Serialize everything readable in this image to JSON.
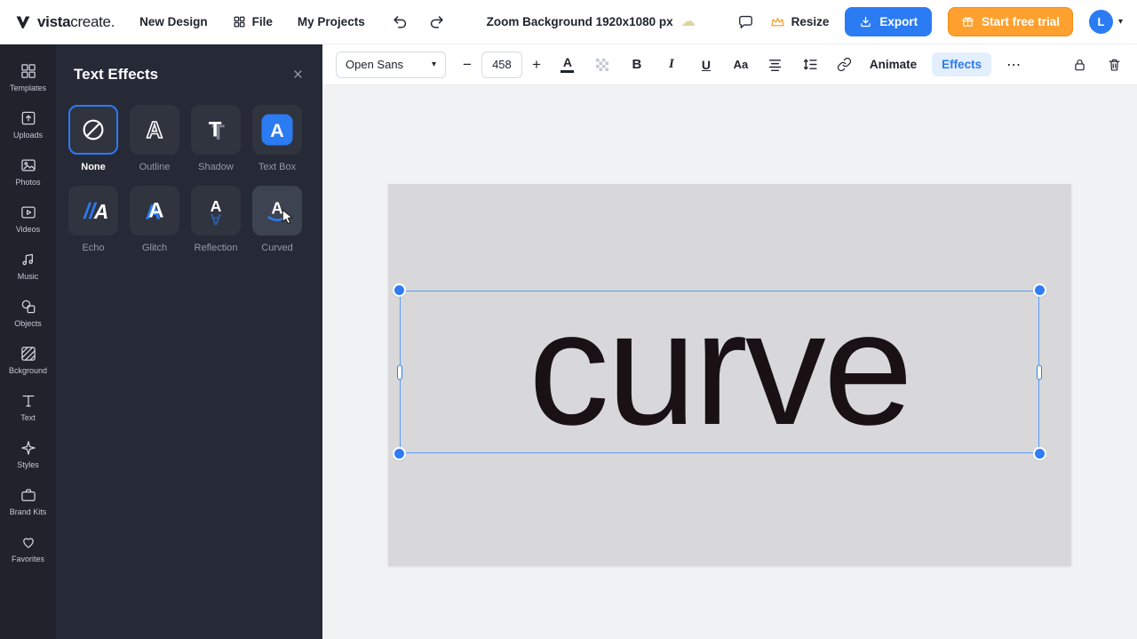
{
  "header": {
    "logo_bold": "vista",
    "logo_rest": "create.",
    "nav_new_design": "New Design",
    "nav_file": "File",
    "nav_my_projects": "My Projects",
    "doc_title": "Zoom Background 1920x1080 px",
    "resize_label": "Resize",
    "export_label": "Export",
    "trial_label": "Start free trial",
    "avatar_initial": "L",
    "caret": "▾"
  },
  "sidebar": {
    "items": [
      {
        "label": "Templates"
      },
      {
        "label": "Uploads"
      },
      {
        "label": "Photos"
      },
      {
        "label": "Videos"
      },
      {
        "label": "Music"
      },
      {
        "label": "Objects"
      },
      {
        "label": "Bckground"
      },
      {
        "label": "Text"
      },
      {
        "label": "Styles"
      },
      {
        "label": "Brand Kits"
      },
      {
        "label": "Favorites"
      }
    ]
  },
  "panel": {
    "title": "Text Effects",
    "close": "×",
    "effects": [
      {
        "label": "None",
        "state": "selected"
      },
      {
        "label": "Outline",
        "state": "default"
      },
      {
        "label": "Shadow",
        "state": "default"
      },
      {
        "label": "Text Box",
        "state": "default"
      },
      {
        "label": "Echo",
        "state": "default"
      },
      {
        "label": "Glitch",
        "state": "default"
      },
      {
        "label": "Reflection",
        "state": "default"
      },
      {
        "label": "Curved",
        "state": "hovered"
      }
    ]
  },
  "toolbar": {
    "font_family": "Open Sans",
    "font_size": "458",
    "minus": "−",
    "plus": "+",
    "text_color_letter": "A",
    "bold": "B",
    "italic": "I",
    "underline": "U",
    "case_label": "Aa",
    "animate_label": "Animate",
    "effects_label": "Effects",
    "more": "⋯",
    "caret": "▾"
  },
  "canvas": {
    "text_content": "curve"
  },
  "colors": {
    "accent_blue": "#2b7bf3",
    "orange": "#ffa02f",
    "dark_navy": "#20222c",
    "panel_bg": "#262936",
    "selection_blue": "#5a9af7",
    "canvas_gray": "#d8d8da",
    "text_color": "#1a1115"
  }
}
